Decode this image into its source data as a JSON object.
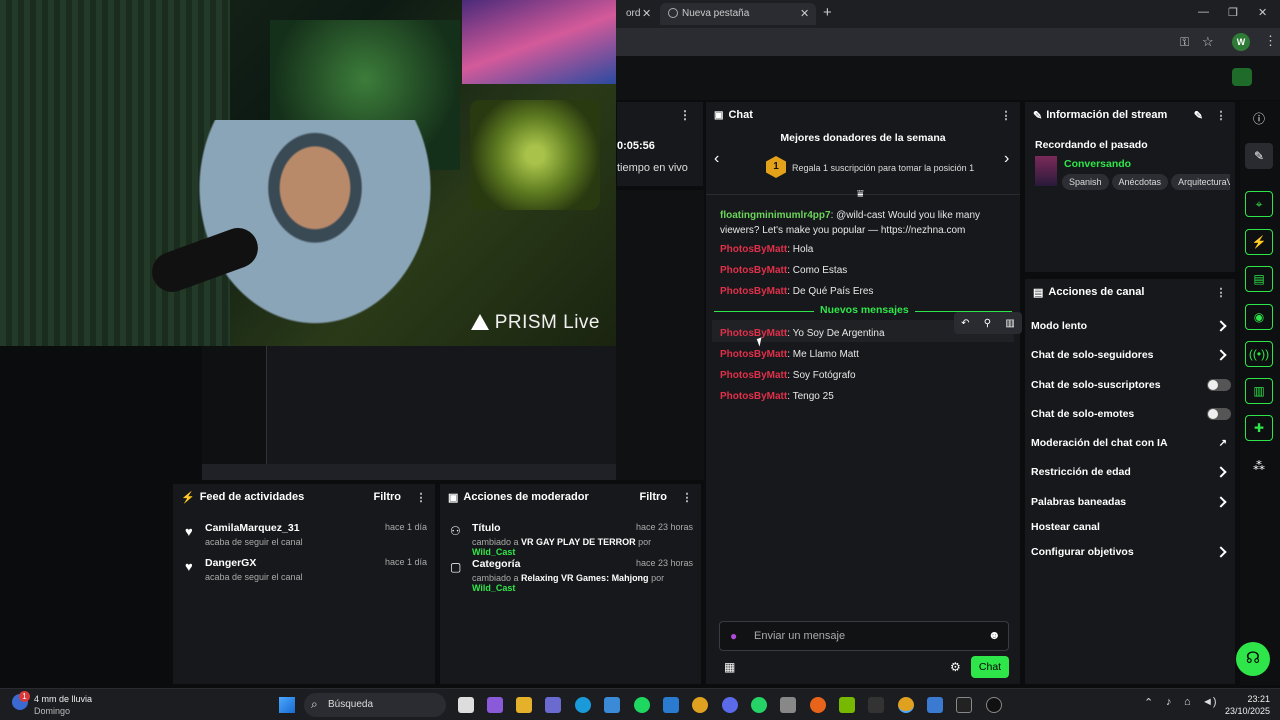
{
  "webcam": {
    "overlay_logo": "PRISM Live"
  },
  "browser": {
    "tabs": [
      {
        "label": "ord"
      },
      {
        "label": "Nueva pestaña"
      }
    ],
    "new_tab_label": "+",
    "profile_initial": "W"
  },
  "stream_stats": {
    "uptime": "0:05:56",
    "live_label": "tiempo en vivo"
  },
  "chat": {
    "title": "Chat",
    "top_donors_title": "Mejores donadores de la semana",
    "donor_rank": "1",
    "donor_prompt": "Regala 1 suscripción para tomar la posición 1",
    "messages_before": [
      {
        "user": "floatingminimumlr4pp7",
        "text": ": @wild-cast Would you like many viewers? Let's make you popular — https://nezhna.com"
      },
      {
        "user": "PhotosByMatt",
        "text": ": Hola"
      },
      {
        "user": "PhotosByMatt",
        "text": ": Como Estas"
      },
      {
        "user": "PhotosByMatt",
        "text": ": De Qué País Eres"
      }
    ],
    "new_messages_label": "Nuevos mensajes",
    "messages_after": [
      {
        "user": "PhotosByMatt",
        "text": ": Yo Soy De Argentina"
      },
      {
        "user": "PhotosByMatt",
        "text": ": Me Llamo Matt"
      },
      {
        "user": "PhotosByMatt",
        "text": ": Soy Fotógrafo"
      },
      {
        "user": "PhotosByMatt",
        "text": ": Tengo 25"
      }
    ],
    "input_placeholder": "Enviar un mensaje",
    "send_label": "Chat"
  },
  "stream_info": {
    "title": "Información del stream",
    "stream_title": "Recordando el pasado",
    "category": "Conversando",
    "tags": [
      "Spanish",
      "Anécdotas",
      "ArquitecturaV"
    ]
  },
  "channel_actions": {
    "title": "Acciones de canal",
    "items": [
      {
        "label": "Modo lento",
        "control": "chevron"
      },
      {
        "label": "Chat de solo-seguidores",
        "control": "chevron"
      },
      {
        "label": "Chat de solo-suscriptores",
        "control": "toggle"
      },
      {
        "label": "Chat de solo-emotes",
        "control": "toggle"
      },
      {
        "label": "Moderación del chat con IA",
        "control": "external"
      },
      {
        "label": "Restricción de edad",
        "control": "chevron"
      },
      {
        "label": "Palabras baneadas",
        "control": "chevron"
      },
      {
        "label": "Hostear canal",
        "control": "none"
      },
      {
        "label": "Configurar objetivos",
        "control": "chevron"
      }
    ]
  },
  "activity_feed": {
    "title": "Feed de actividades",
    "filter_label": "Filtro",
    "events": [
      {
        "name": "CamilaMarquez_31",
        "desc": "acaba de seguir el canal",
        "time": "hace 1 día"
      },
      {
        "name": "DangerGX",
        "desc": "acaba de seguir el canal",
        "time": "hace 1 día"
      }
    ]
  },
  "mod_actions": {
    "title": "Acciones de moderador",
    "filter_label": "Filtro",
    "events": [
      {
        "name": "Título",
        "prefix": "cambiado a ",
        "value": "VR GAY PLAY DE TERROR",
        "by": " por ",
        "actor": "Wild_Cast",
        "time": "hace 23 horas"
      },
      {
        "name": "Categoría",
        "prefix": "cambiado a ",
        "value": "Relaxing VR Games: Mahjong",
        "by": " por ",
        "actor": "Wild_Cast",
        "time": "hace 23 horas"
      }
    ]
  },
  "taskbar": {
    "weather_line1": "4 mm de lluvia",
    "weather_line2": "Domingo",
    "weather_badge": "1",
    "search_label": "Búsqueda",
    "time": "23:21",
    "date": "23/10/2025"
  },
  "colors": {
    "accent": "#2fe64a",
    "username": "#e0304a",
    "spam_user": "#6bd45a",
    "panel": "#17181b"
  }
}
